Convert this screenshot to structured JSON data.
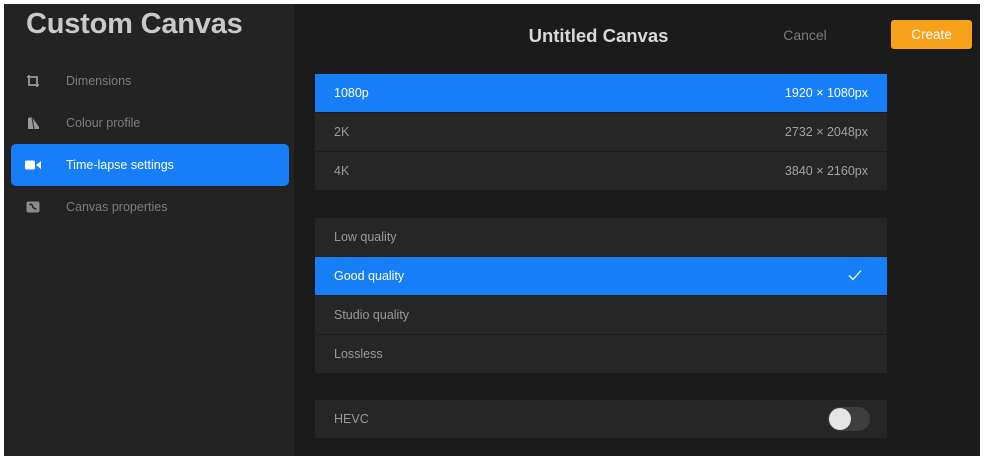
{
  "sidebar": {
    "title": "Custom Canvas",
    "items": [
      {
        "label": "Dimensions",
        "icon": "dimensions-icon",
        "active": false
      },
      {
        "label": "Colour profile",
        "icon": "colour-profile-icon",
        "active": false
      },
      {
        "label": "Time-lapse settings",
        "icon": "video-camera-icon",
        "active": true
      },
      {
        "label": "Canvas properties",
        "icon": "canvas-properties-icon",
        "active": false
      }
    ]
  },
  "header": {
    "title": "Untitled Canvas",
    "cancel_label": "Cancel",
    "create_label": "Create"
  },
  "resolutions": [
    {
      "label": "1080p",
      "size": "1920 × 1080px",
      "selected": true
    },
    {
      "label": "2K",
      "size": "2732 × 2048px",
      "selected": false
    },
    {
      "label": "4K",
      "size": "3840 × 2160px",
      "selected": false
    }
  ],
  "qualities": [
    {
      "label": "Low quality",
      "selected": false
    },
    {
      "label": "Good quality",
      "selected": true
    },
    {
      "label": "Studio quality",
      "selected": false
    },
    {
      "label": "Lossless",
      "selected": false
    }
  ],
  "hevc": {
    "label": "HEVC",
    "enabled": false
  },
  "colors": {
    "accent": "#167ff7",
    "create_button": "#f8a21c",
    "background": "#1b1b1b",
    "sidebar": "#232323"
  }
}
